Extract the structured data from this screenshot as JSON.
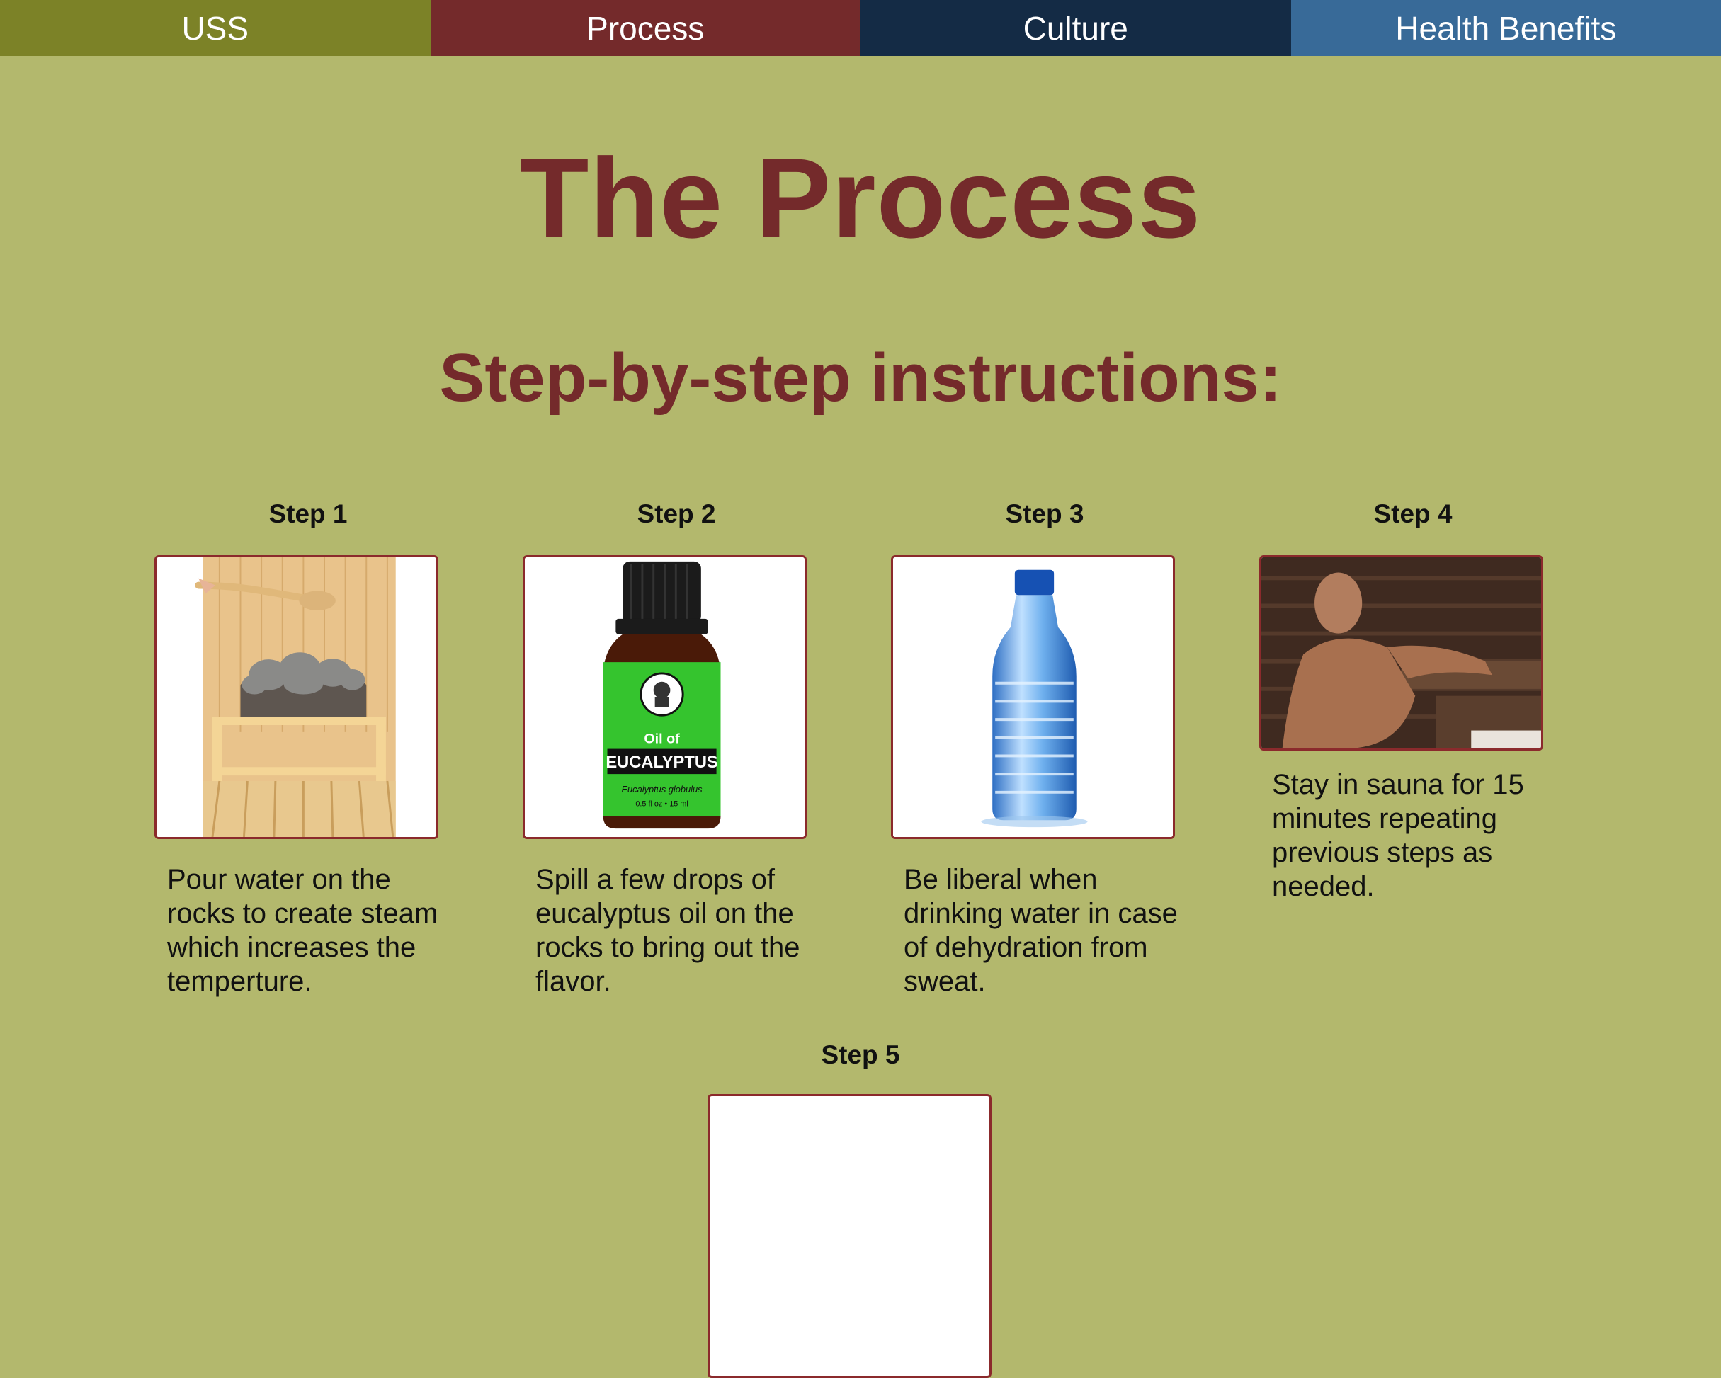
{
  "nav": {
    "items": [
      {
        "label": "USS",
        "color": "#7c8227"
      },
      {
        "label": "Process",
        "color": "#742a2b"
      },
      {
        "label": "Culture",
        "color": "#142b45"
      },
      {
        "label": "Health Benefits",
        "color": "#386a98"
      }
    ]
  },
  "page": {
    "title": "The Process",
    "subtitle": "Step-by-step instructions:",
    "background": "#b3b86d",
    "accent": "#742a2b"
  },
  "steps": [
    {
      "label": "Step 1",
      "image": "sauna-rocks-ladle-photo",
      "text": "Pour water on the rocks to create steam which increases the temperture."
    },
    {
      "label": "Step 2",
      "image": "eucalyptus-oil-bottle-photo",
      "text": "Spill a few drops of eucalyptus oil on the rocks to bring out the flavor.",
      "bottle_label": {
        "top": "Oil of",
        "main": "EUCALYPTUS",
        "latin": "Eucalyptus globulus",
        "size": "0.5 fl oz • 15 ml"
      }
    },
    {
      "label": "Step 3",
      "image": "water-bottle-photo",
      "text": "Be liberal when drinking water in case of dehydration from sweat."
    },
    {
      "label": "Step 4",
      "image": "man-in-sauna-photo",
      "text": "Stay in sauna for 15 minutes repeating previous steps as needed."
    },
    {
      "label": "Step 5"
    }
  ]
}
